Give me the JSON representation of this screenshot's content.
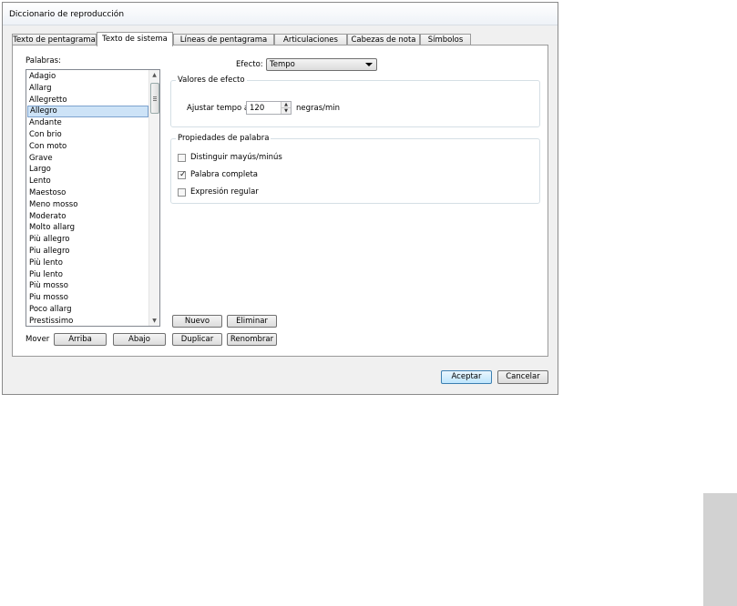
{
  "window": {
    "title": "Diccionario de reproducción"
  },
  "tabs": [
    {
      "label": "Texto de pentagrama",
      "active": false
    },
    {
      "label": "Texto de sistema",
      "active": true
    },
    {
      "label": "Líneas de pentagrama",
      "active": false
    },
    {
      "label": "Articulaciones",
      "active": false
    },
    {
      "label": "Cabezas de nota",
      "active": false
    },
    {
      "label": "Símbolos",
      "active": false
    }
  ],
  "words": {
    "label": "Palabras:",
    "selected": "Allegro",
    "items": [
      "Adagio",
      "Allarg",
      "Allegretto",
      "Allegro",
      "Andante",
      "Con brio",
      "Con moto",
      "Grave",
      "Largo",
      "Lento",
      "Maestoso",
      "Meno mosso",
      "Moderato",
      "Molto allarg",
      "Più allegro",
      "Piu allegro",
      "Più lento",
      "Piu lento",
      "Più mosso",
      "Piu mosso",
      "Poco allarg",
      "Prestissimo"
    ]
  },
  "move": {
    "label": "Mover",
    "up": "Arriba",
    "down": "Abajo",
    "duplicate": "Duplicar",
    "rename": "Renombrar",
    "new": "Nuevo",
    "delete": "Eliminar"
  },
  "effect": {
    "label": "Efecto:",
    "value": "Tempo"
  },
  "effect_values": {
    "title": "Valores de efecto",
    "tempo_label": "Ajustar tempo a:",
    "tempo_value": "120",
    "unit": "negras/min"
  },
  "word_props": {
    "title": "Propiedades de palabra",
    "case": {
      "label": "Distinguir mayús/minús",
      "checked": false
    },
    "whole": {
      "label": "Palabra completa",
      "checked": true
    },
    "regex": {
      "label": "Expresión regular",
      "checked": false
    }
  },
  "footer": {
    "ok": "Aceptar",
    "cancel": "Cancelar"
  },
  "icons": {
    "check": "✓",
    "arrow_up": "▲",
    "arrow_down": "▼"
  }
}
